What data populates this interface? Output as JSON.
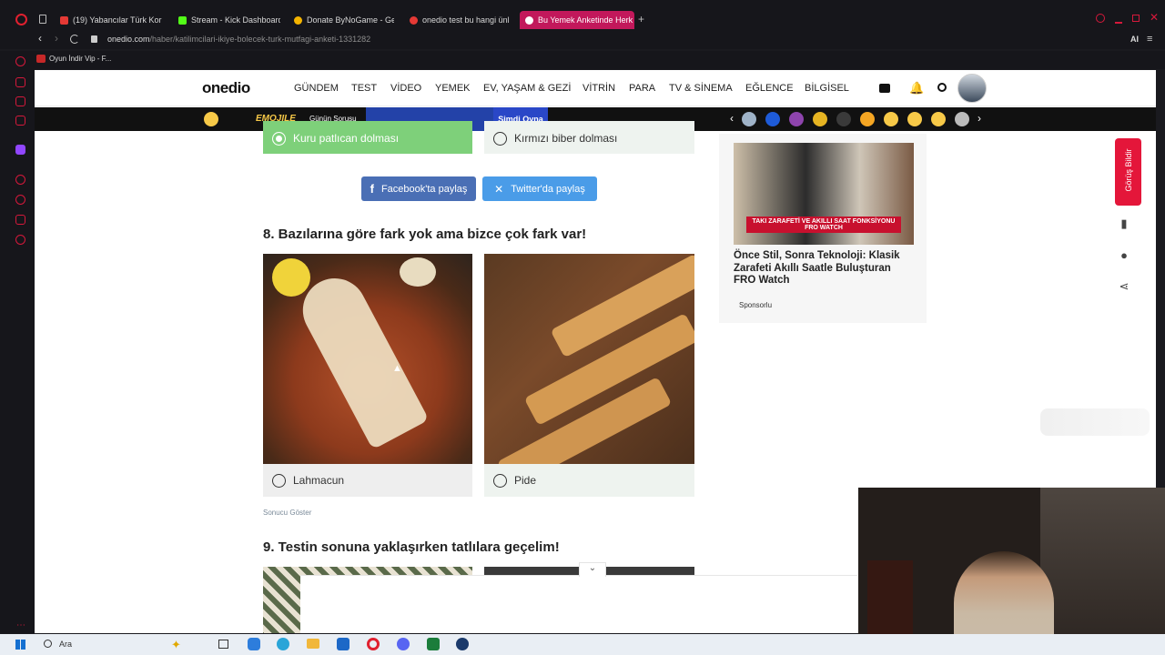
{
  "browser": {
    "tabs": [
      {
        "label": "(19) Yabancılar Türk Korku",
        "color": "#e53935"
      },
      {
        "label": "Stream - Kick Dashboard",
        "color": "#53fc18"
      },
      {
        "label": "Donate ByNoGame - Gele",
        "color": "#f4b400"
      },
      {
        "label": "onedio test bu hangi ünl",
        "color": "#e53935"
      },
      {
        "label": "Bu Yemek Anketinde Herk",
        "color": "#ffffff"
      }
    ],
    "url_host": "onedio.com",
    "url_path": "/haber/katilimcilari-ikiye-bolecek-turk-mutfagi-anketi-1331282",
    "bookmark": "Oyun İndir Vip - F...",
    "ai_label": "AI"
  },
  "site": {
    "logo": "onedio",
    "nav": [
      "GÜNDEM",
      "TEST",
      "VİDEO",
      "YEMEK",
      "EV, YAŞAM & GEZİ",
      "VİTRİN",
      "PARA",
      "TV & SİNEMA",
      "EĞLENCE",
      "BİLGİSEL"
    ],
    "promo_game": "Günün Sorusu",
    "promo_logo": "EMOJILE",
    "promo_play": "Şimdi Oyna"
  },
  "quiz": {
    "prev_options": [
      "Kuru patlıcan dolması",
      "Kırmızı biber dolması"
    ],
    "share_facebook": "Facebook'ta paylaş",
    "share_twitter": "Twitter'da paylaş",
    "q8_title": "8. Bazılarına göre fark yok ama bizce çok fark var!",
    "q8_options": [
      "Lahmacun",
      "Pide"
    ],
    "show_result": "Sonucu Göster",
    "q9_title": "9. Testin sonuna yaklaşırken tatlılara geçelim!"
  },
  "ad": {
    "banner_text": "TAKI ZARAFETİ VE AKILLI SAAT FONKSİYONU",
    "banner_brand": "FRO WATCH",
    "title": "Önce Stil, Sonra Teknoloji: Klasik Zarafeti Akıllı Saatle Buluşturan FRO Watch",
    "sponsor": "Sponsorlu"
  },
  "feedback": "Görüş Bildir",
  "taskbar": {
    "search": "Ara"
  },
  "colors": {
    "accent": "#e4163a",
    "selected_green": "#7ed07a",
    "option_bg": "#eef3ef",
    "facebook": "#4a6fb5",
    "twitter": "#4a9ce8"
  }
}
